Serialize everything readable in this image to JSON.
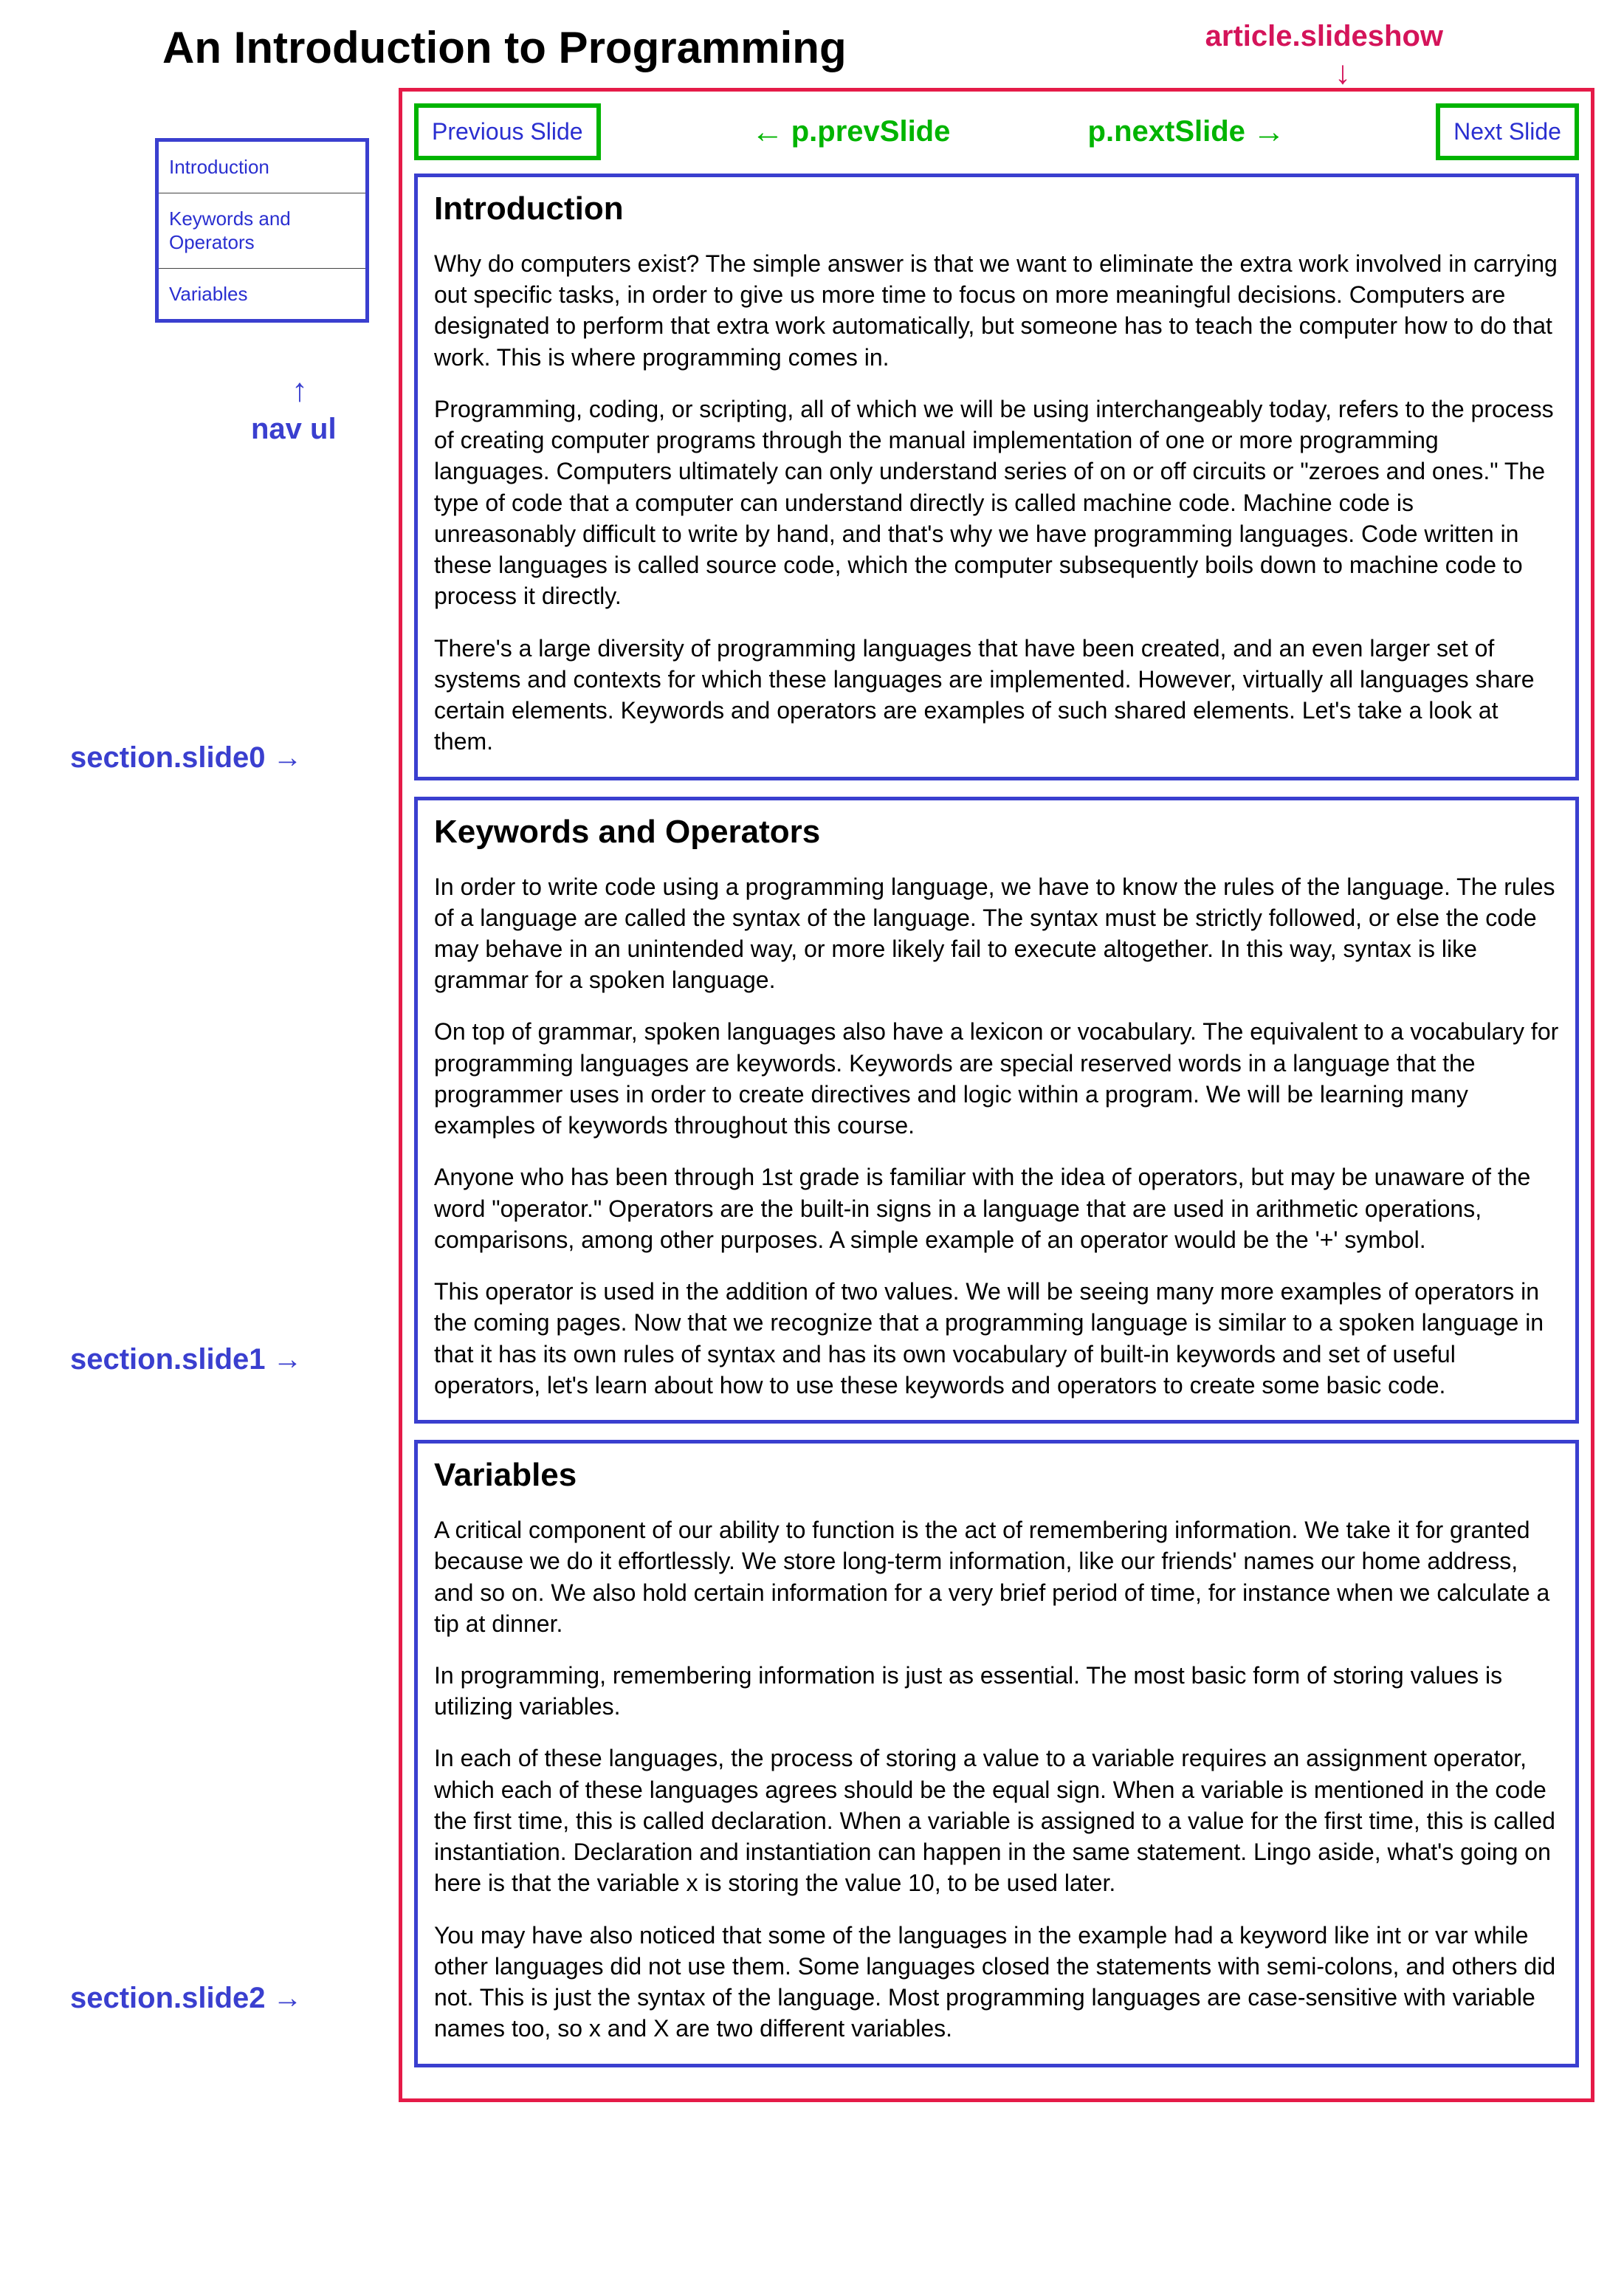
{
  "page_title": "An Introduction to Programming",
  "annotations": {
    "article": "article.slideshow",
    "nav_ul": "nav ul",
    "prev_slide": "p.prevSlide",
    "next_slide": "p.nextSlide",
    "section0": "section.slide0",
    "section1": "section.slide1",
    "section2": "section.slide2"
  },
  "controls": {
    "prev_label": "Previous Slide",
    "next_label": "Next Slide"
  },
  "nav": {
    "items": [
      {
        "label": "Introduction"
      },
      {
        "label": "Keywords and Operators"
      },
      {
        "label": "Variables"
      }
    ]
  },
  "slides": [
    {
      "heading": "Introduction",
      "paragraphs": [
        "Why do computers exist? The simple answer is that we want to eliminate the extra work involved in carrying out specific tasks, in order to give us more time to focus on more meaningful decisions. Computers are designated to perform that extra work automatically, but someone has to teach the computer how to do that work. This is where programming comes in.",
        "Programming, coding, or scripting, all of which we will be using interchangeably today, refers to the process of creating computer programs through the manual implementation of one or more programming languages. Computers ultimately can only understand series of on or off circuits or \"zeroes and ones.\" The type of code that a computer can understand directly is called machine code. Machine code is unreasonably difficult to write by hand, and that's why we have programming languages. Code written in these languages is called source code, which the computer subsequently boils down to machine code to process it directly.",
        "There's a large diversity of programming languages that have been created, and an even larger set of systems and contexts for which these languages are implemented. However, virtually all languages share certain elements. Keywords and operators are examples of such shared elements. Let's take a look at them."
      ]
    },
    {
      "heading": "Keywords and Operators",
      "paragraphs": [
        "In order to write code using a programming language, we have to know the rules of the language. The rules of a language are called the syntax of the language. The syntax must be strictly followed, or else the code may behave in an unintended way, or more likely fail to execute altogether. In this way, syntax is like grammar for a spoken language.",
        "On top of grammar, spoken languages also have a lexicon or vocabulary. The equivalent to a vocabulary for programming languages are keywords. Keywords are special reserved words in a language that the programmer uses in order to create directives and logic within a program. We will be learning many examples of keywords throughout this course.",
        "Anyone who has been through 1st grade is familiar with the idea of operators, but may be unaware of the word \"operator.\" Operators are the built-in signs in a language that are used in arithmetic operations, comparisons, among other purposes. A simple example of an operator would be the '+' symbol.",
        "This operator is used in the addition of two values. We will be seeing many more examples of operators in the coming pages. Now that we recognize that a programming language is similar to a spoken language in that it has its own rules of syntax and has its own vocabulary of built-in keywords and set of useful operators, let's learn about how to use these keywords and operators to create some basic code."
      ]
    },
    {
      "heading": "Variables",
      "paragraphs": [
        "A critical component of our ability to function is the act of remembering information. We take it for granted because we do it effortlessly. We store long-term information, like our friends' names our home address, and so on. We also hold certain information for a very brief period of time, for instance when we calculate a tip at dinner.",
        "In programming, remembering information is just as essential. The most basic form of storing values is utilizing variables.",
        "In each of these languages, the process of storing a value to a variable requires an assignment operator, which each of these languages agrees should be the equal sign. When a variable is mentioned in the code the first time, this is called declaration. When a variable is assigned to a value for the first time, this is called instantiation. Declaration and instantiation can happen in the same statement. Lingo aside, what's going on here is that the variable x is storing the value 10, to be used later.",
        "You may have also noticed that some of the languages in the example had a keyword like int or var while other languages did not use them. Some languages closed the statements with semi-colons, and others did not. This is just the syntax of the language. Most programming languages are case-sensitive with variable names too, so x and X are two different variables."
      ]
    }
  ]
}
